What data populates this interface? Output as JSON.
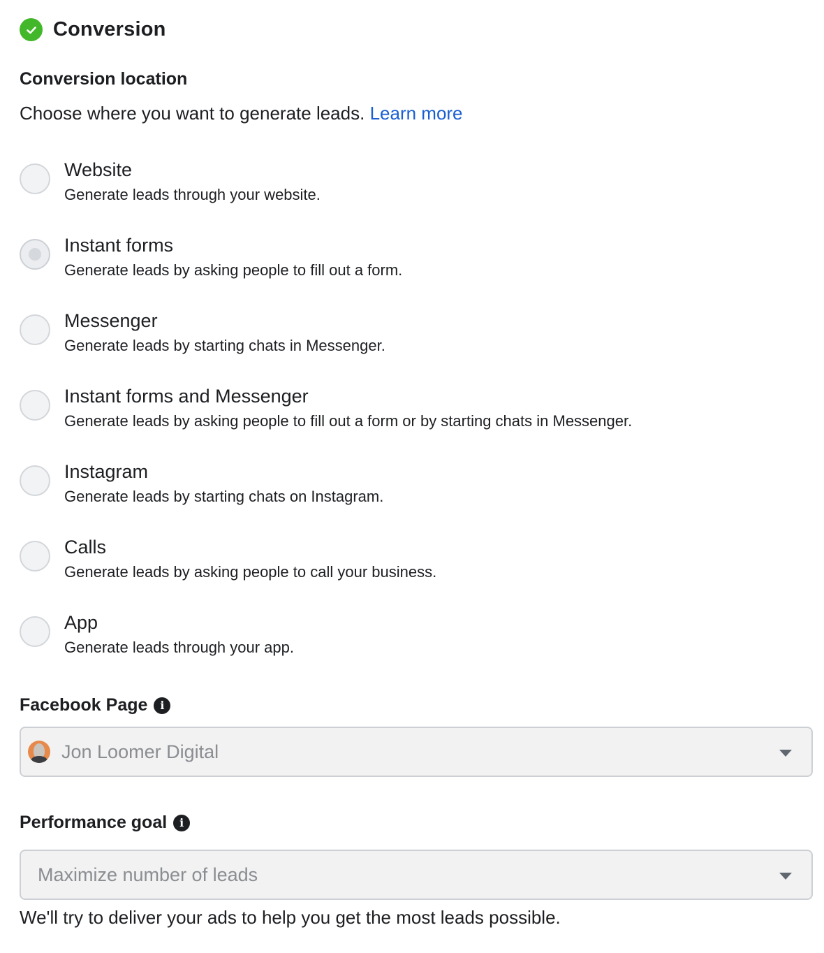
{
  "header": {
    "title": "Conversion",
    "status_icon": "check-circle-icon",
    "status_color": "#42b72a"
  },
  "conversion_location": {
    "label": "Conversion location",
    "description": "Choose where you want to generate leads.",
    "learn_more": "Learn more",
    "options": [
      {
        "title": "Website",
        "subtitle": "Generate leads through your website.",
        "selected": false
      },
      {
        "title": "Instant forms",
        "subtitle": "Generate leads by asking people to fill out a form.",
        "selected": true
      },
      {
        "title": "Messenger",
        "subtitle": "Generate leads by starting chats in Messenger.",
        "selected": false
      },
      {
        "title": "Instant forms and Messenger",
        "subtitle": "Generate leads by asking people to fill out a form or by starting chats in Messenger.",
        "selected": false
      },
      {
        "title": "Instagram",
        "subtitle": "Generate leads by starting chats on Instagram.",
        "selected": false
      },
      {
        "title": "Calls",
        "subtitle": "Generate leads by asking people to call your business.",
        "selected": false
      },
      {
        "title": "App",
        "subtitle": "Generate leads through your app.",
        "selected": false
      }
    ]
  },
  "facebook_page": {
    "label": "Facebook Page",
    "selected_value": "Jon Loomer Digital"
  },
  "performance_goal": {
    "label": "Performance goal",
    "selected_value": "Maximize number of leads",
    "help_text": "We'll try to deliver your ads to help you get the most leads possible."
  },
  "colors": {
    "link": "#1a5fd1",
    "text": "#1c1e21",
    "muted": "#8a8d91"
  }
}
